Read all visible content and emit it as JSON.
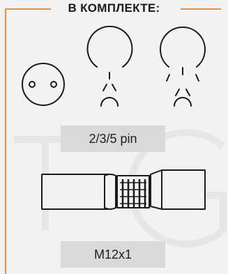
{
  "header": {
    "title": "В КОМПЛЕКТЕ:"
  },
  "items": {
    "pins_label": "2/3/5 pin",
    "thread_label": "M12x1"
  },
  "colors": {
    "accent": "#e8933a",
    "label_bg": "#d9d9d9",
    "background": "#f2f2f2"
  },
  "icons": [
    "socket-2-pin-icon",
    "socket-3-pin-icon",
    "socket-5-pin-icon",
    "m12-connector-icon"
  ]
}
